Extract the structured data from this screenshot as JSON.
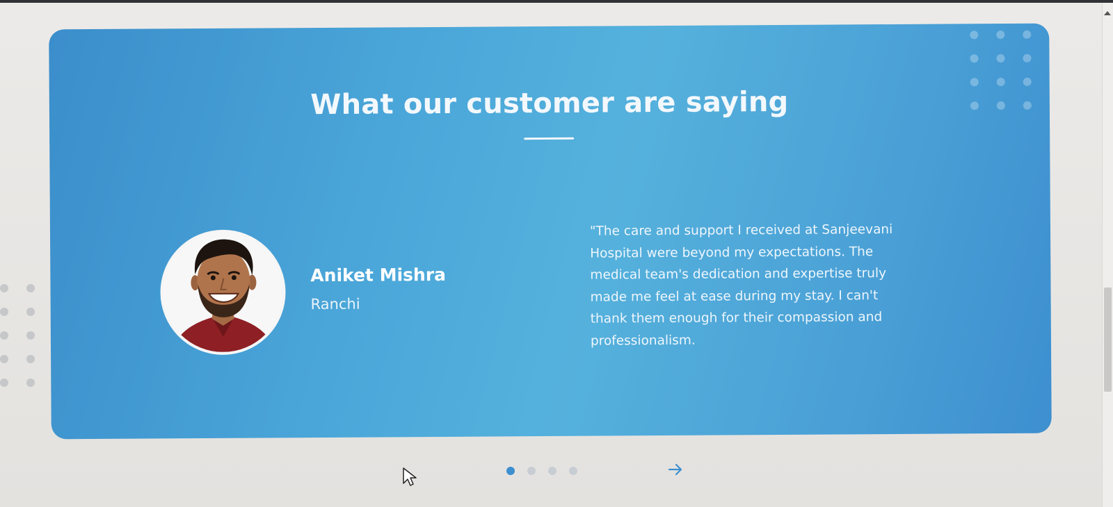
{
  "section": {
    "title": "What our customer are saying"
  },
  "testimonial": {
    "name": "Aniket Mishra",
    "city": "Ranchi",
    "quote": "\"The care and support I received at Sanjeevani Hospital were beyond my expectations. The medical team's dedication and expertise truly made me feel at ease during my stay. I can't thank them enough for their compassion and professionalism."
  },
  "carousel": {
    "total_slides": 4,
    "active_slide": 1,
    "next_icon": "arrow-right-icon"
  },
  "colors": {
    "card_primary": "#4aa7da",
    "accent_dot_active": "#3d8fcf",
    "dot_inactive": "#c7cdd3"
  }
}
